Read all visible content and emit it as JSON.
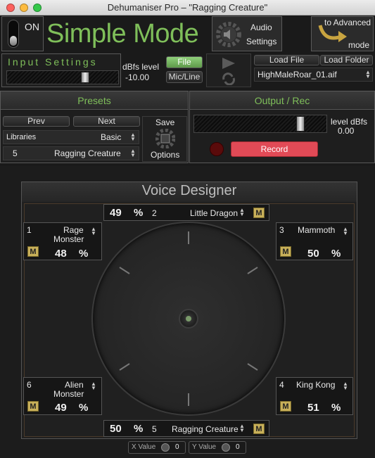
{
  "window": {
    "title": "Dehumaniser Pro – \"Ragging Creature\""
  },
  "header": {
    "power_label": "ON",
    "mode_title": "Simple Mode",
    "audio_settings_line1": "Audio",
    "audio_settings_line2": "Settings",
    "advanced_line1": "to Advanced",
    "advanced_line2": "mode"
  },
  "input_settings": {
    "title": "Input Settings",
    "level_label": "dBfs level",
    "level_value": "-10.00",
    "file_button": "File",
    "mic_button": "Mic/Line",
    "load_file": "Load File",
    "load_folder": "Load Folder",
    "file_name": "HighMaleRoar_01.aif"
  },
  "presets": {
    "title": "Presets",
    "prev": "Prev",
    "next": "Next",
    "save": "Save",
    "options": "Options",
    "libraries_label": "Libraries",
    "libraries_value": "Basic",
    "preset_number": "5",
    "preset_name": "Ragging Creature"
  },
  "output": {
    "title": "Output / Rec",
    "level_label": "level dBfs",
    "level_value": "0.00",
    "record_button": "Record"
  },
  "voice_designer": {
    "title": "Voice Designer",
    "slots": {
      "top": {
        "pct": "49",
        "unit": "%",
        "num": "2",
        "name": "Little Dragon",
        "m": "M"
      },
      "tl": {
        "num": "1",
        "name_line1": "Rage",
        "name_line2": "Monster",
        "pct": "48",
        "unit": "%",
        "m": "M"
      },
      "tr": {
        "num": "3",
        "name": "Mammoth",
        "pct": "50",
        "unit": "%",
        "m": "M"
      },
      "bl": {
        "num": "6",
        "name_line1": "Alien",
        "name_line2": "Monster",
        "pct": "49",
        "unit": "%",
        "m": "M"
      },
      "br": {
        "num": "4",
        "name": "King Kong",
        "pct": "51",
        "unit": "%",
        "m": "M"
      },
      "bottom": {
        "pct": "50",
        "unit": "%",
        "num": "5",
        "name": "Ragging Creature",
        "m": "M"
      }
    },
    "x_label": "X Value",
    "x_value": "0",
    "y_label": "Y Value",
    "y_value": "0"
  },
  "colors": {
    "accent_green": "#7fbf5a",
    "record_red": "#e14a56",
    "m_button": "#c8b05a"
  }
}
